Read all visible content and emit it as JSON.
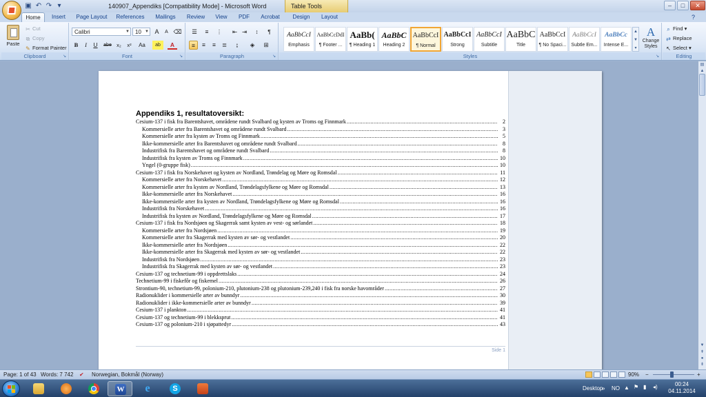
{
  "window": {
    "title": "140907_Appendiks [Compatibility Mode] - Microsoft Word",
    "contextual_group": "Table Tools",
    "minimize": "–",
    "maximize": "□",
    "close": "✕"
  },
  "quick_access": {
    "save_icon": "save-icon",
    "undo_icon": "undo-icon",
    "redo_icon": "redo-icon"
  },
  "tabs": [
    "Home",
    "Insert",
    "Page Layout",
    "References",
    "Mailings",
    "Review",
    "View",
    "PDF",
    "Acrobat",
    "Design",
    "Layout"
  ],
  "active_tab": "Home",
  "ribbon": {
    "clipboard": {
      "label": "Clipboard",
      "paste": "Paste",
      "cut": "Cut",
      "copy": "Copy",
      "format_painter": "Format Painter"
    },
    "font": {
      "label": "Font",
      "font_name": "Calibri",
      "font_size": "10",
      "grow": "A",
      "shrink": "A",
      "bold": "B",
      "italic": "I",
      "underline": "U",
      "strike": "abe",
      "subscript": "x₂",
      "superscript": "x²",
      "change_case": "Aa",
      "highlight": "ab",
      "font_color": "A"
    },
    "paragraph": {
      "label": "Paragraph"
    },
    "styles": {
      "label": "Styles",
      "tiles": [
        {
          "preview": "AaBbCcI",
          "name": "Emphasis"
        },
        {
          "preview": "AaBbCcDdI",
          "name": "¶ Footer ..."
        },
        {
          "preview": "AaBb(",
          "name": "¶ Heading 1"
        },
        {
          "preview": "AaBbC",
          "name": "Heading 2"
        },
        {
          "preview": "AaBbCcI",
          "name": "¶ Normal"
        },
        {
          "preview": "AaBbCcI",
          "name": "Strong"
        },
        {
          "preview": "AaBbCcI",
          "name": "Subtitle"
        },
        {
          "preview": "AaBbC",
          "name": "Title"
        },
        {
          "preview": "AaBbCcI",
          "name": "¶ No Spaci..."
        },
        {
          "preview": "AaBbCcI",
          "name": "Subtle Em..."
        },
        {
          "preview": "AaBbCc",
          "name": "Intense E..."
        }
      ],
      "selected_index": 4,
      "change_styles": "Change Styles"
    },
    "editing": {
      "label": "Editing",
      "find": "Find",
      "replace": "Replace",
      "select": "Select"
    }
  },
  "document": {
    "heading": "Appendiks 1, resultatoversikt:",
    "toc": [
      {
        "text": "Cesium-137 i fisk fra Barentshavet, områdene rundt Svalbard og kysten av Troms og Finnmark",
        "page": "2",
        "level": 1
      },
      {
        "text": "Kommersielle arter fra Barentshavet og områdene rundt Svalbard",
        "page": "3",
        "level": 2
      },
      {
        "text": "Kommersielle arter fra kysten av Troms og Finnmark",
        "page": "5",
        "level": 2
      },
      {
        "text": "Ikke-kommersielle arter fra Barentshavet og områdene rundt Svalbard",
        "page": "8",
        "level": 2
      },
      {
        "text": "Industrifisk fra Barentshavet og områdene rundt Svalbard",
        "page": "8",
        "level": 2
      },
      {
        "text": "Industrifisk fra kysten av Troms og Finnmark",
        "page": "10",
        "level": 2
      },
      {
        "text": "Yngel (0-gruppe fisk)",
        "page": "10",
        "level": 2
      },
      {
        "text": "Cesium-137 i fisk fra Norskehavet og kysten av Nordland, Trøndelag og Møre og Romsdal",
        "page": "11",
        "level": 1
      },
      {
        "text": "Kommersielle arter fra Norskehavet",
        "page": "12",
        "level": 2
      },
      {
        "text": "Kommersielle arter fra kysten av Nordland, Trøndelagsfylkene og Møre og Romsdal",
        "page": "13",
        "level": 2
      },
      {
        "text": "Ikke-kommersielle arter fra Norskehavet",
        "page": "16",
        "level": 2
      },
      {
        "text": "Ikke-kommersielle arter fra kysten av Nordland, Trøndelagsfylkene og Møre og Romsdal",
        "page": "16",
        "level": 2
      },
      {
        "text": "Industrifisk fra Norskehavet",
        "page": "16",
        "level": 2
      },
      {
        "text": "Industrifisk fra kysten av Nordland, Trøndelagsfylkene og Møre og Romsdal",
        "page": "17",
        "level": 2
      },
      {
        "text": "Cesium-137 i fisk fra Nordsjøen og Skagerrak samt kysten av vest- og sørlandet",
        "page": "18",
        "level": 1
      },
      {
        "text": "Kommersielle arter fra Nordsjøen",
        "page": "19",
        "level": 2
      },
      {
        "text": "Kommersielle arter fra Skagerrak med kysten av sør- og vestlandet",
        "page": "20",
        "level": 2
      },
      {
        "text": "Ikke-kommersielle arter fra Nordsjøen",
        "page": "22",
        "level": 2
      },
      {
        "text": "Ikke-kommersielle arter fra Skagerrak med kysten av sør- og vestlandet",
        "page": "22",
        "level": 2
      },
      {
        "text": "Industrifisk fra Nordsjøen",
        "page": "23",
        "level": 2
      },
      {
        "text": "Industrifisk fra Skagerrak med kysten av sør- og vestlandet",
        "page": "23",
        "level": 2
      },
      {
        "text": "Cesium-137 og technetium-99 i oppdrettslaks",
        "page": "24",
        "level": 1
      },
      {
        "text": "Technetium-99 i fiskefôr og fiskemel",
        "page": "26",
        "level": 1
      },
      {
        "text": "Strontium-90, technetium-99, polonium-210, plutonium-238 og plutonium-239,240 i fisk fra norske havområder",
        "page": "27",
        "level": 1
      },
      {
        "text": "Radionuklider i kommersielle arter av bunndyr",
        "page": "30",
        "level": 1
      },
      {
        "text": "Radionuklider i ikke-kommersielle arter av bunndyr",
        "page": "39",
        "level": 1
      },
      {
        "text": "Cesium-137 i plankton",
        "page": "41",
        "level": 1
      },
      {
        "text": "Cesium-137 og technetium-99 i blekksprut",
        "page": "41",
        "level": 1
      },
      {
        "text": "Cesium-137 og polonium-210 i sjøpattedyr",
        "page": "43",
        "level": 1
      }
    ],
    "footer": "Side 1"
  },
  "status": {
    "page": "Page: 1 of 43",
    "words": "Words: 7 742",
    "language": "Norwegian, Bokmål (Norway)",
    "zoom": "90%",
    "zoom_minus": "−",
    "zoom_plus": "+"
  },
  "taskbar": {
    "desktop": "Desktop",
    "language": "NO",
    "time": "00:24",
    "date": "04.11.2014"
  },
  "colors": {
    "ribbon_blue": "#dfe9f7",
    "tab_text": "#15428b",
    "selected_style": "#f1a634"
  }
}
